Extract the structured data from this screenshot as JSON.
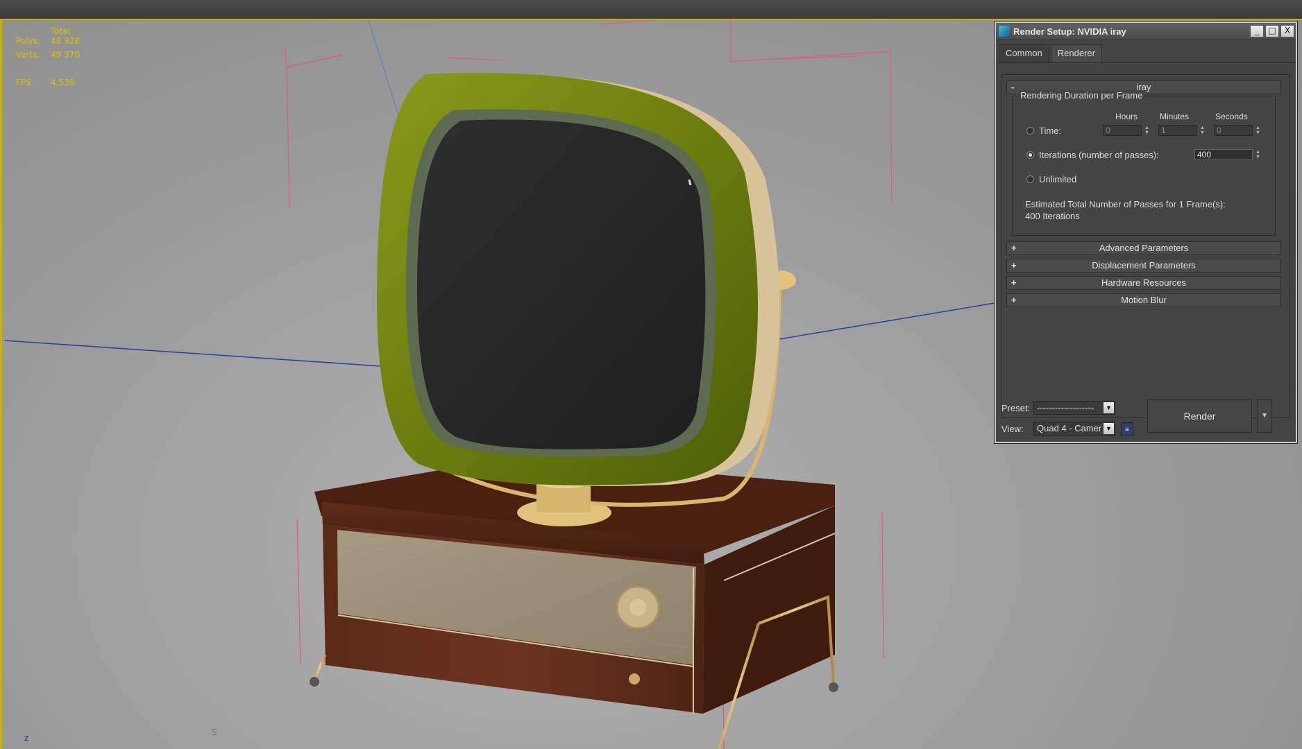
{
  "viewport": {
    "stats": {
      "total_label": "Total",
      "polys_label": "Polys:",
      "polys_value": "48 928",
      "verts_label": "Verts:",
      "verts_value": "49 370",
      "fps_label": "FPS:",
      "fps_value": "4,530"
    },
    "axis_label": "z",
    "corner_label": "S",
    "stats_color": "#d4c000",
    "frame_color": "#c8b400"
  },
  "dialog": {
    "title": "Render Setup: NVIDIA iray",
    "window_buttons": [
      "_",
      "□",
      "X"
    ],
    "tabs": [
      {
        "label": "Common",
        "active": false
      },
      {
        "label": "Renderer",
        "active": true
      }
    ],
    "iray_rollout": {
      "sign": "-",
      "title": "iray",
      "group_title": "Rendering Duration per Frame",
      "col_hours": "Hours",
      "col_minutes": "Minutes",
      "col_seconds": "Seconds",
      "time_label": "Time:",
      "time_hours": "0",
      "time_minutes": "1",
      "time_seconds": "0",
      "iterations_label": "Iterations (number of passes):",
      "iterations_value": "400",
      "unlimited_label": "Unlimited",
      "selected_option": "iterations",
      "estimate_line1": "Estimated Total Number of Passes for 1 Frame(s):",
      "estimate_line2": "400 Iterations"
    },
    "collapsed_rollouts": [
      {
        "sign": "+",
        "title": "Advanced Parameters"
      },
      {
        "sign": "+",
        "title": "Displacement Parameters"
      },
      {
        "sign": "+",
        "title": "Hardware Resources"
      },
      {
        "sign": "+",
        "title": "Motion Blur"
      }
    ],
    "preset_label": "Preset:",
    "preset_value": "-------------------",
    "view_label": "View:",
    "view_value": "Quad 4 - Camer",
    "render_button": "Render"
  }
}
